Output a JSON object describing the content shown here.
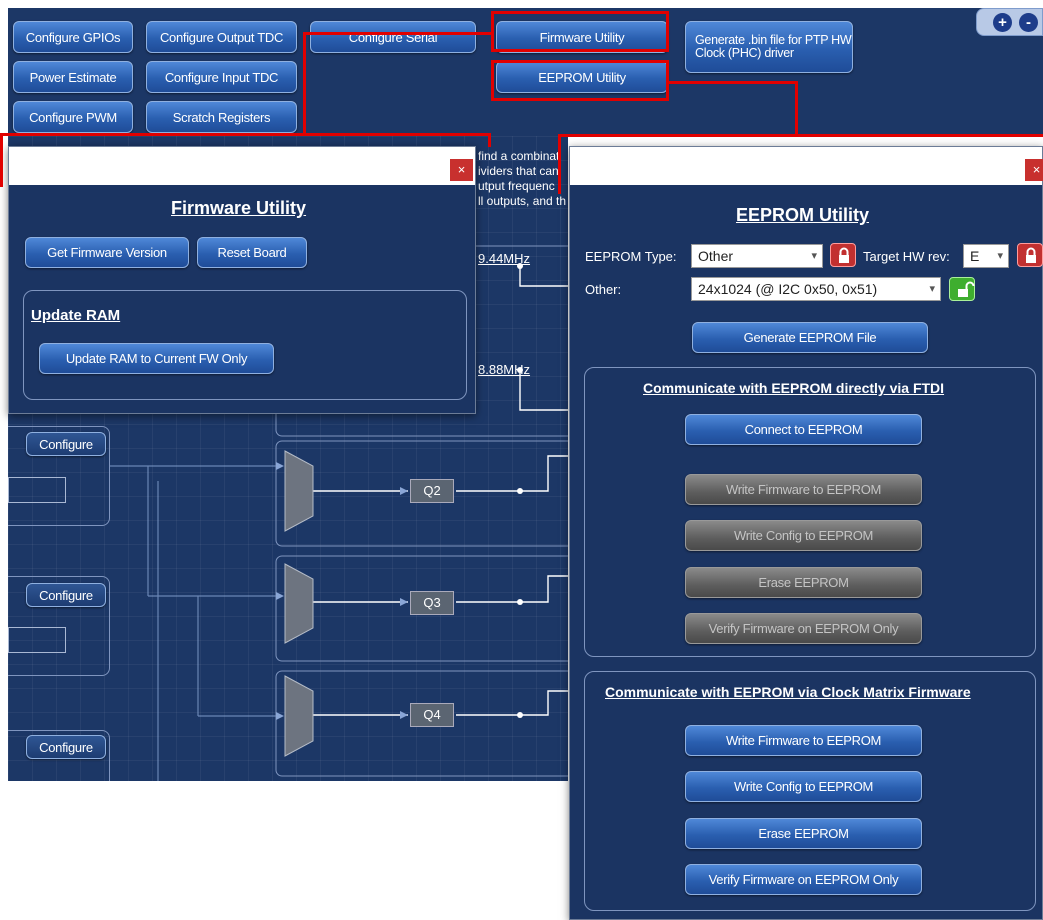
{
  "toolbar": {
    "buttons": {
      "configure_gpios": "Configure GPIOs",
      "configure_output_tdc": "Configure Output TDC",
      "configure_serial": "Configure Serial",
      "firmware_utility": "Firmware Utility",
      "generate_bin": "Generate .bin file for PTP HW Clock (PHC) driver",
      "power_estimate": "Power Estimate",
      "configure_input_tdc": "Configure Input TDC",
      "eeprom_utility": "EEPROM Utility",
      "configure_pwm": "Configure PWM",
      "scratch_registers": "Scratch Registers"
    },
    "zoom_in": "+",
    "zoom_out": "-"
  },
  "diagram": {
    "description_lines": [
      "find a combinat",
      "ividers that can",
      "utput frequenc",
      "ll outputs, and th"
    ],
    "freq_1": "9.44MHz",
    "freq_2": "8.88MHz",
    "configure_label": "Configure",
    "outputs": [
      "Q2",
      "Q3",
      "Q4"
    ]
  },
  "firmware_window": {
    "close": "×",
    "title": "Firmware Utility",
    "get_version": "Get Firmware Version",
    "reset_board": "Reset Board",
    "update_ram_title": "Update RAM",
    "update_ram_button": "Update RAM to Current FW Only"
  },
  "eeprom_window": {
    "close": "×",
    "title": "EEPROM Utility",
    "eeprom_type_label": "EEPROM Type:",
    "eeprom_type_value": "Other",
    "target_hw_label": "Target HW rev:",
    "target_hw_value": "E",
    "other_label": "Other:",
    "other_value": "24x1024 (@ I2C 0x50, 0x51)",
    "generate_file": "Generate EEPROM File",
    "ftdi_group": {
      "title": "Communicate with EEPROM directly via FTDI",
      "connect": "Connect to EEPROM",
      "write_firmware": "Write Firmware to EEPROM",
      "write_config": "Write Config to EEPROM",
      "erase": "Erase EEPROM",
      "verify": "Verify Firmware on EEPROM Only"
    },
    "firmware_group": {
      "title": "Communicate with EEPROM via Clock Matrix Firmware",
      "write_firmware": "Write Firmware to EEPROM",
      "write_config": "Write Config to EEPROM",
      "erase": "Erase EEPROM",
      "verify": "Verify Firmware on EEPROM Only"
    }
  },
  "colors": {
    "panel_bg": "#1b3462",
    "button_blue": "#2a5fb0",
    "highlight_red": "#e10000",
    "close_red": "#c8302e"
  }
}
